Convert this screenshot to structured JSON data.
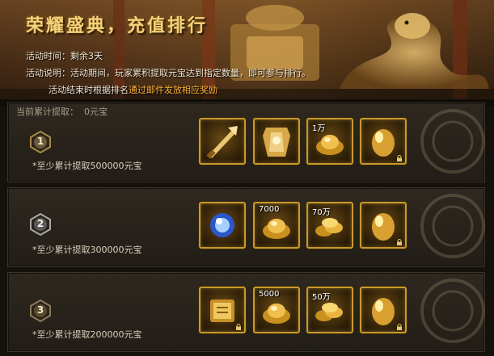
{
  "banner": {
    "title": "荣耀盛典，充值排行",
    "time_label": "活动时间：",
    "time_value": "剩余3天",
    "desc_label": "活动说明：",
    "desc_text": "活动期间，玩家累积提取元宝达到指定数量，即可参与排行。",
    "end_note_pre": "活动结束时根据排名",
    "end_note_hl": "通过邮件发放相应奖励"
  },
  "progress": {
    "label": "当前累计提取：",
    "value": "0元宝"
  },
  "tiers": [
    {
      "rank": "1",
      "requirement": "*至少累计提取500000元宝",
      "rewards": [
        {
          "icon": "weapon-icon",
          "amount": "",
          "locked": false
        },
        {
          "icon": "armor-icon",
          "amount": "",
          "locked": false
        },
        {
          "icon": "gold-ingot-icon",
          "amount": "1万",
          "locked": false
        },
        {
          "icon": "gold-egg-icon",
          "amount": "",
          "locked": true
        }
      ]
    },
    {
      "rank": "2",
      "requirement": "*至少累计提取300000元宝",
      "rewards": [
        {
          "icon": "blue-orb-icon",
          "amount": "",
          "locked": false
        },
        {
          "icon": "gold-ingot-icon",
          "amount": "7000",
          "locked": false
        },
        {
          "icon": "gold-coins-icon",
          "amount": "70万",
          "locked": false
        },
        {
          "icon": "gold-egg-icon",
          "amount": "",
          "locked": true
        }
      ]
    },
    {
      "rank": "3",
      "requirement": "*至少累计提取200000元宝",
      "rewards": [
        {
          "icon": "scroll-book-icon",
          "amount": "",
          "locked": true
        },
        {
          "icon": "gold-ingot-icon",
          "amount": "5000",
          "locked": false
        },
        {
          "icon": "gold-coins-icon",
          "amount": "50万",
          "locked": false
        },
        {
          "icon": "gold-egg-icon",
          "amount": "",
          "locked": true
        }
      ]
    }
  ],
  "colors": {
    "gold": "#f4d27a",
    "highlight": "#ffb43a",
    "slot_border": "#c89a2c"
  }
}
